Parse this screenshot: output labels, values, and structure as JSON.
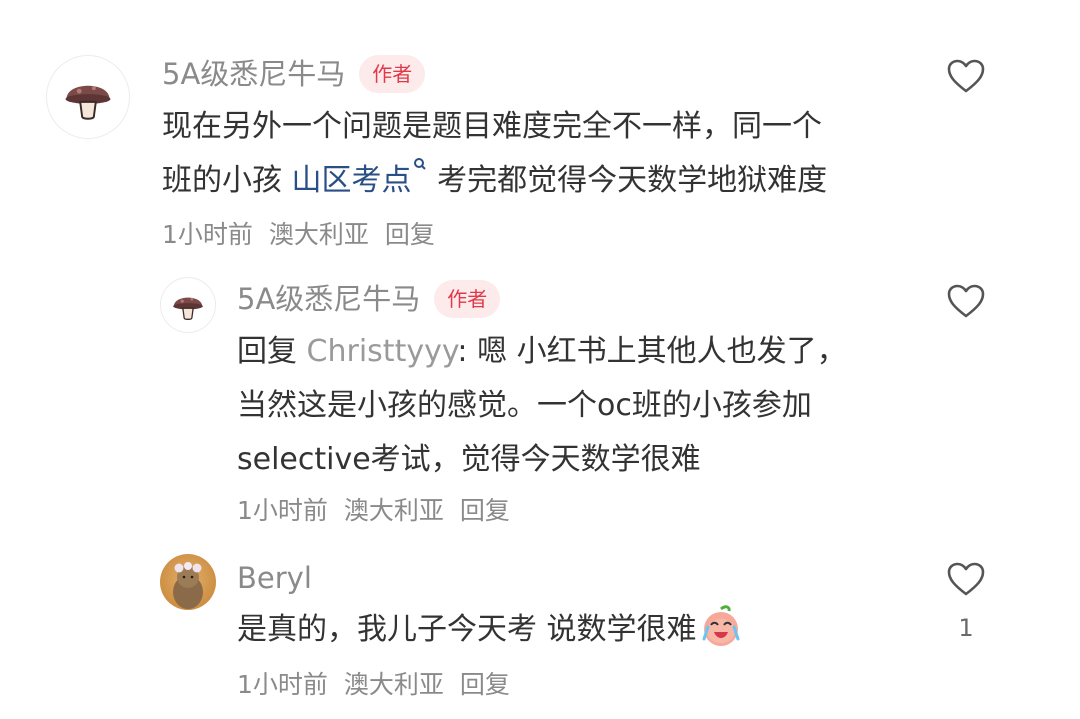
{
  "comments": [
    {
      "author": "5A级悉尼牛马",
      "badge": "作者",
      "line1": "现在另外一个问题是题目难度完全不一样，同一个",
      "line2_pre": "班的小孩 ",
      "link": "山区考点",
      "line2_post": " 考完都觉得今天数学地狱难度",
      "time": "1小时前",
      "location": "澳大利亚",
      "reply": "回复",
      "avatar_icon": "mushroom-avatar-icon"
    },
    {
      "author": "5A级悉尼牛马",
      "badge": "作者",
      "reply_prefix": "回复 ",
      "reply_user": "Christtyyy",
      "line1_rest": ": 嗯 小红书上其他人也发了，",
      "line2": "当然这是小孩的感觉。一个oc班的小孩参加",
      "line3": "selective考试，觉得今天数学很难",
      "time": "1小时前",
      "location": "澳大利亚",
      "reply": "回复",
      "avatar_icon": "mushroom-avatar-icon"
    },
    {
      "author": "Beryl",
      "line1": "是真的，我儿子今天考 说数学很难",
      "emoji": "crying-laughing-peach-emoji",
      "time": "1小时前",
      "location": "澳大利亚",
      "reply": "回复",
      "likes": "1",
      "avatar_icon": "bear-photo-avatar-icon"
    }
  ],
  "colors": {
    "badge_bg": "#fdeaea",
    "badge_text": "#e0394a",
    "link": "#2a4f86",
    "meta": "#8a8a8a",
    "body_text": "#333333"
  }
}
